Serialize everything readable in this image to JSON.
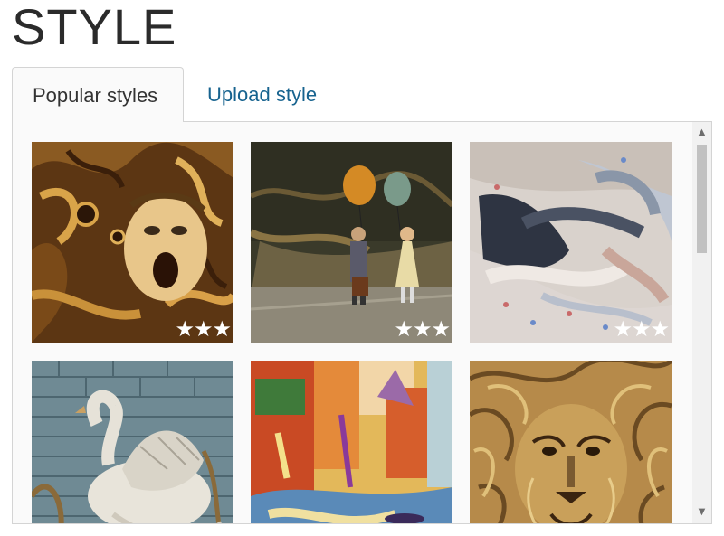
{
  "header": {
    "title": "STYLE"
  },
  "tabs": [
    {
      "label": "Popular styles",
      "active": true
    },
    {
      "label": "Upload style",
      "active": false
    }
  ],
  "styles": [
    {
      "name": "screaming-face",
      "rating": "★★★"
    },
    {
      "name": "balloon-children",
      "rating": "★★★"
    },
    {
      "name": "sleeping-figure",
      "rating": "★★★"
    },
    {
      "name": "swan-relief",
      "rating": ""
    },
    {
      "name": "venice-canal",
      "rating": ""
    },
    {
      "name": "lion-face",
      "rating": ""
    }
  ],
  "scrollbar": {
    "up_icon": "▲",
    "down_icon": "▼"
  },
  "colors": {
    "link": "#17638f",
    "title": "#2b2b2b",
    "border": "#d4d4d4"
  }
}
